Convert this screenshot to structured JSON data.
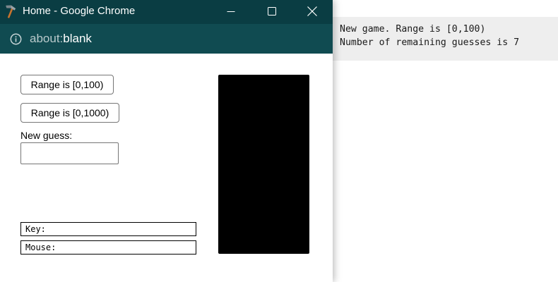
{
  "window": {
    "title": "Home - Google Chrome",
    "titlebar_color": "#0a3d43",
    "addressbar_color": "#104b51",
    "icons": {
      "app": "hammer-icon",
      "minimize": "minimize-icon",
      "maximize": "maximize-icon",
      "close": "close-icon",
      "info": "info-icon"
    }
  },
  "address": {
    "scheme": "about:",
    "path": "blank"
  },
  "page": {
    "range_100_label": "Range is [0,100)",
    "range_1000_label": "Range is [0,1000)",
    "guess_label": "New guess:",
    "guess_value": "",
    "key_label": "Key:",
    "mouse_label": "Mouse:",
    "canvas_color": "#000000"
  },
  "console": {
    "lines": [
      "New game. Range is [0,100)",
      "Number of remaining guesses is 7"
    ]
  }
}
